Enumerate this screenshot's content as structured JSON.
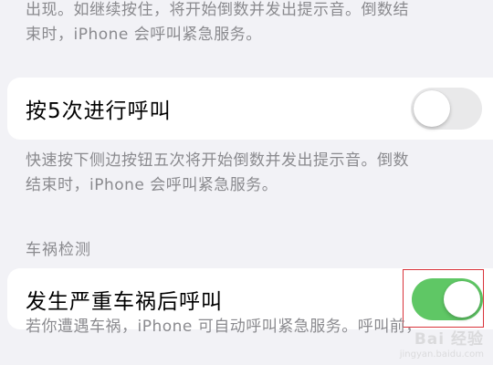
{
  "side_button_footnote": "出现。如继续按住，将开始倒数并发出提示音。倒数结\n束时，iPhone 会呼叫紧急服务。",
  "press_five_times": {
    "label": "按5次进行呼叫",
    "enabled": false,
    "footnote": "快速按下侧边按钮五次将开始倒数并发出提示音。倒数\n结束时，iPhone 会呼叫紧急服务。"
  },
  "crash_detection": {
    "section_header": "车祸检测",
    "label": "发生严重车祸后呼叫",
    "enabled": true,
    "footnote": "若你遭遇车祸，iPhone 可自动呼叫紧急服务。呼叫前，"
  },
  "watermark": {
    "text": "Bai 经验",
    "sub": "jingyan.baidu.com"
  },
  "colors": {
    "toggle_on": "#5fc765",
    "toggle_off": "#e9e9ea",
    "highlight": "#d9333a",
    "background": "#f2f2f6"
  }
}
